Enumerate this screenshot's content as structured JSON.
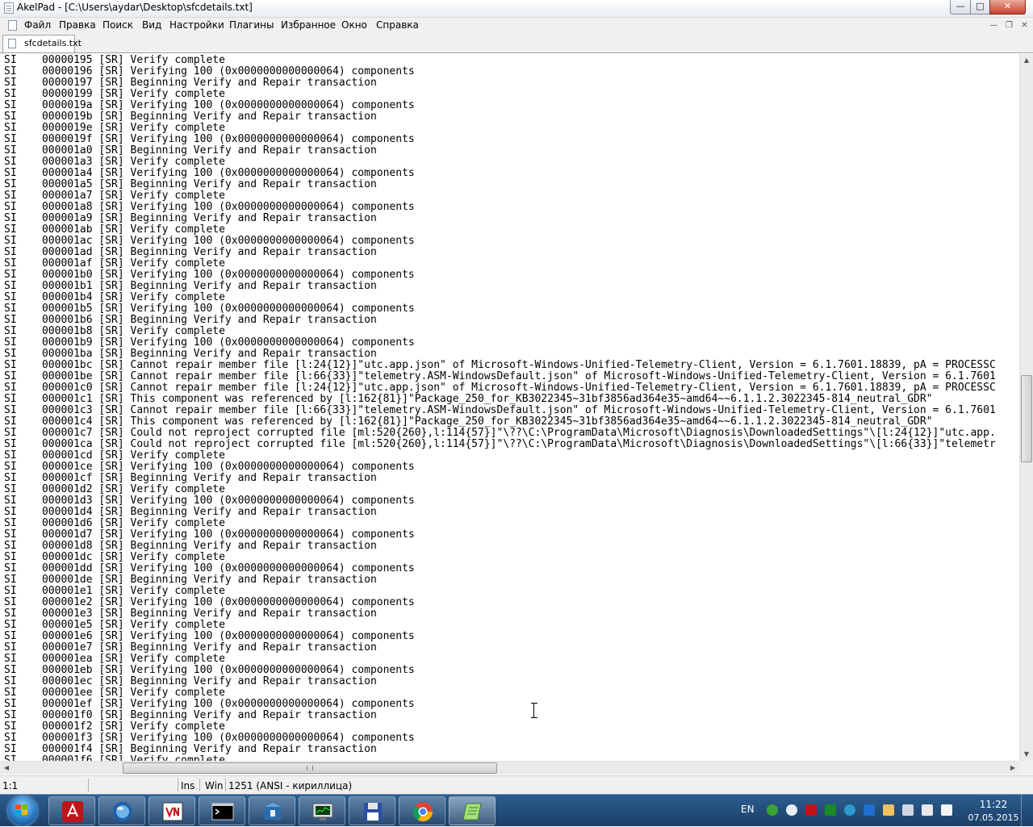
{
  "window": {
    "title": "AkelPad - [C:\\Users\\aydar\\Desktop\\sfcdetails.txt]",
    "buttons": {
      "minimize_glyph": "—",
      "maximize_glyph": "□",
      "close_glyph": "✕"
    }
  },
  "menubar": {
    "items": [
      "Файл",
      "Правка",
      "Поиск",
      "Вид",
      "Настройки",
      "Плагины",
      "Избранное",
      "Окно",
      "Справка"
    ],
    "mdi_buttons": {
      "minimize_glyph": "—",
      "restore_glyph": "❐",
      "close_glyph": "✕"
    }
  },
  "tabs": [
    {
      "label": "sfcdetails.txt",
      "active": true
    }
  ],
  "editor": {
    "lines": [
      "SI    00000195 [SR] Verify complete",
      "SI    00000196 [SR] Verifying 100 (0x0000000000000064) components",
      "SI    00000197 [SR] Beginning Verify and Repair transaction",
      "SI    00000199 [SR] Verify complete",
      "SI    0000019a [SR] Verifying 100 (0x0000000000000064) components",
      "SI    0000019b [SR] Beginning Verify and Repair transaction",
      "SI    0000019e [SR] Verify complete",
      "SI    0000019f [SR] Verifying 100 (0x0000000000000064) components",
      "SI    000001a0 [SR] Beginning Verify and Repair transaction",
      "SI    000001a3 [SR] Verify complete",
      "SI    000001a4 [SR] Verifying 100 (0x0000000000000064) components",
      "SI    000001a5 [SR] Beginning Verify and Repair transaction",
      "SI    000001a7 [SR] Verify complete",
      "SI    000001a8 [SR] Verifying 100 (0x0000000000000064) components",
      "SI    000001a9 [SR] Beginning Verify and Repair transaction",
      "SI    000001ab [SR] Verify complete",
      "SI    000001ac [SR] Verifying 100 (0x0000000000000064) components",
      "SI    000001ad [SR] Beginning Verify and Repair transaction",
      "SI    000001af [SR] Verify complete",
      "SI    000001b0 [SR] Verifying 100 (0x0000000000000064) components",
      "SI    000001b1 [SR] Beginning Verify and Repair transaction",
      "SI    000001b4 [SR] Verify complete",
      "SI    000001b5 [SR] Verifying 100 (0x0000000000000064) components",
      "SI    000001b6 [SR] Beginning Verify and Repair transaction",
      "SI    000001b8 [SR] Verify complete",
      "SI    000001b9 [SR] Verifying 100 (0x0000000000000064) components",
      "SI    000001ba [SR] Beginning Verify and Repair transaction",
      "SI    000001bc [SR] Cannot repair member file [l:24{12}]\"utc.app.json\" of Microsoft-Windows-Unified-Telemetry-Client, Version = 6.1.7601.18839, pA = PROCESSC",
      "SI    000001be [SR] Cannot repair member file [l:66{33}]\"telemetry.ASM-WindowsDefault.json\" of Microsoft-Windows-Unified-Telemetry-Client, Version = 6.1.7601",
      "SI    000001c0 [SR] Cannot repair member file [l:24{12}]\"utc.app.json\" of Microsoft-Windows-Unified-Telemetry-Client, Version = 6.1.7601.18839, pA = PROCESSC",
      "SI    000001c1 [SR] This component was referenced by [l:162{81}]\"Package_250_for_KB3022345~31bf3856ad364e35~amd64~~6.1.1.2.3022345-814_neutral_GDR\"",
      "SI    000001c3 [SR] Cannot repair member file [l:66{33}]\"telemetry.ASM-WindowsDefault.json\" of Microsoft-Windows-Unified-Telemetry-Client, Version = 6.1.7601",
      "SI    000001c4 [SR] This component was referenced by [l:162{81}]\"Package_250_for_KB3022345~31bf3856ad364e35~amd64~~6.1.1.2.3022345-814_neutral_GDR\"",
      "SI    000001c7 [SR] Could not reproject corrupted file [ml:520{260},l:114{57}]\"\\??\\C:\\ProgramData\\Microsoft\\Diagnosis\\DownloadedSettings\"\\[l:24{12}]\"utc.app.",
      "SI    000001ca [SR] Could not reproject corrupted file [ml:520{260},l:114{57}]\"\\??\\C:\\ProgramData\\Microsoft\\Diagnosis\\DownloadedSettings\"\\[l:66{33}]\"telemetr",
      "SI    000001cd [SR] Verify complete",
      "SI    000001ce [SR] Verifying 100 (0x0000000000000064) components",
      "SI    000001cf [SR] Beginning Verify and Repair transaction",
      "SI    000001d2 [SR] Verify complete",
      "SI    000001d3 [SR] Verifying 100 (0x0000000000000064) components",
      "SI    000001d4 [SR] Beginning Verify and Repair transaction",
      "SI    000001d6 [SR] Verify complete",
      "SI    000001d7 [SR] Verifying 100 (0x0000000000000064) components",
      "SI    000001d8 [SR] Beginning Verify and Repair transaction",
      "SI    000001dc [SR] Verify complete",
      "SI    000001dd [SR] Verifying 100 (0x0000000000000064) components",
      "SI    000001de [SR] Beginning Verify and Repair transaction",
      "SI    000001e1 [SR] Verify complete",
      "SI    000001e2 [SR] Verifying 100 (0x0000000000000064) components",
      "SI    000001e3 [SR] Beginning Verify and Repair transaction",
      "SI    000001e5 [SR] Verify complete",
      "SI    000001e6 [SR] Verifying 100 (0x0000000000000064) components",
      "SI    000001e7 [SR] Beginning Verify and Repair transaction",
      "SI    000001ea [SR] Verify complete",
      "SI    000001eb [SR] Verifying 100 (0x0000000000000064) components",
      "SI    000001ec [SR] Beginning Verify and Repair transaction",
      "SI    000001ee [SR] Verify complete",
      "SI    000001ef [SR] Verifying 100 (0x0000000000000064) components",
      "SI    000001f0 [SR] Beginning Verify and Repair transaction",
      "SI    000001f2 [SR] Verify complete",
      "SI    000001f3 [SR] Verifying 100 (0x0000000000000064) components",
      "SI    000001f4 [SR] Beginning Verify and Repair transaction",
      "SI    000001f6 [SR] Verify complete"
    ]
  },
  "statusbar": {
    "position": "1:1",
    "insert_mode": "Ins",
    "newline": "Win",
    "codepage": "1251  (ANSI - кириллица)"
  },
  "taskbar": {
    "apps": [
      {
        "icon": "adobe-reader-icon",
        "active": false
      },
      {
        "icon": "globe-orb-icon",
        "active": false
      },
      {
        "icon": "vnc-icon",
        "active": false
      },
      {
        "icon": "command-prompt-icon",
        "active": false
      },
      {
        "icon": "installer-box-icon",
        "active": false
      },
      {
        "icon": "task-manager-monitor-icon",
        "active": false
      },
      {
        "icon": "floppy-disk-icon",
        "active": false
      },
      {
        "icon": "chrome-icon",
        "active": false
      },
      {
        "icon": "akelpad-notepad-icon",
        "active": true
      }
    ],
    "tray": {
      "language": "EN",
      "icons": [
        "security-check-icon",
        "cloud-icon",
        "en-layout-icon",
        "green-app-icon",
        "e-browser-icon",
        "teamviewer-icon",
        "network-folder-icon",
        "volume-icon",
        "network-icon",
        "action-center-flag-icon"
      ],
      "time": "11:22",
      "date": "07.05.2015"
    }
  },
  "colors": {
    "taskbar_top": "#2c5d8f",
    "taskbar_bottom": "#1b3f66",
    "close_button": "#c7432c",
    "text": "#000000"
  }
}
